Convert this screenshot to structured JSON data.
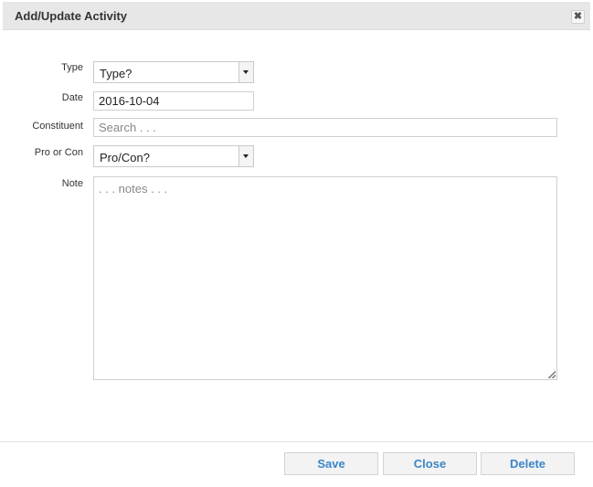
{
  "dialog": {
    "title": "Add/Update Activity",
    "close_icon": "close-icon",
    "close_glyph": "✖"
  },
  "form": {
    "type": {
      "label": "Type",
      "value": "Type?"
    },
    "date": {
      "label": "Date",
      "value": "2016-10-04"
    },
    "constituent": {
      "label": "Constituent",
      "value": "",
      "placeholder": "Search . . ."
    },
    "pro_con": {
      "label": "Pro or Con",
      "value": "Pro/Con?"
    },
    "note": {
      "label": "Note",
      "value": "",
      "placeholder": ". . . notes . . ."
    }
  },
  "buttons": {
    "save": "Save",
    "close": "Close",
    "delete": "Delete"
  },
  "colors": {
    "button_text": "#3b86c8",
    "titlebar_bg": "#e7e7e7"
  }
}
